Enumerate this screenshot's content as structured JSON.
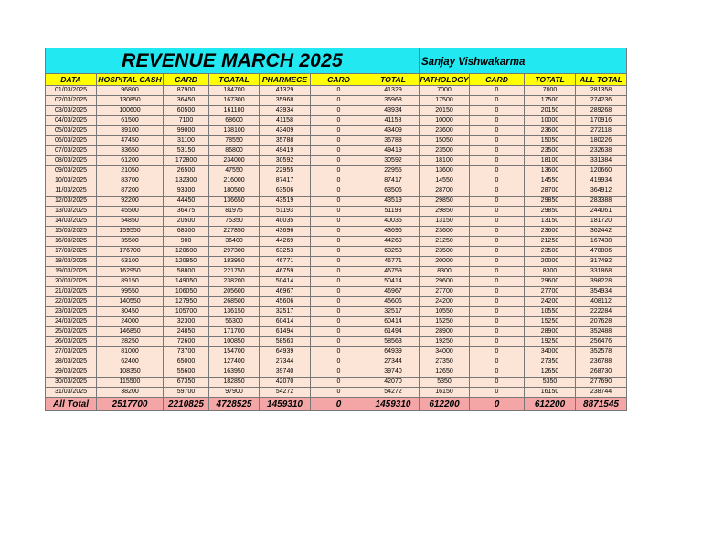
{
  "title": "REVENUE MARCH 2025",
  "author": "Sanjay Vishwakarma",
  "columns": [
    "DATA",
    "HOSPITAL CASH",
    "CARD",
    "TOATAL",
    "PHARMECE",
    "CARD",
    "TOTAL",
    "PATHOLOGY",
    "CARD",
    "TOTATL",
    "ALL TOTAL"
  ],
  "rows": [
    [
      "01/03/2025",
      "96800",
      "87900",
      "184700",
      "41329",
      "0",
      "41329",
      "7000",
      "0",
      "7000",
      "281358"
    ],
    [
      "02/03/2025",
      "130850",
      "36450",
      "167300",
      "35968",
      "0",
      "35968",
      "17500",
      "0",
      "17500",
      "274236"
    ],
    [
      "03/03/2025",
      "100600",
      "60500",
      "161100",
      "43934",
      "0",
      "43934",
      "20150",
      "0",
      "20150",
      "289268"
    ],
    [
      "04/03/2025",
      "61500",
      "7100",
      "68600",
      "41158",
      "0",
      "41158",
      "10000",
      "0",
      "10000",
      "170916"
    ],
    [
      "05/03/2025",
      "39100",
      "99000",
      "138100",
      "43409",
      "0",
      "43409",
      "23600",
      "0",
      "23600",
      "272118"
    ],
    [
      "06/03/2025",
      "47450",
      "31100",
      "78550",
      "35788",
      "0",
      "35788",
      "15050",
      "0",
      "15050",
      "180226"
    ],
    [
      "07/03/2025",
      "33650",
      "53150",
      "86800",
      "49419",
      "0",
      "49419",
      "23500",
      "0",
      "23500",
      "232638"
    ],
    [
      "08/03/2025",
      "61200",
      "172800",
      "234000",
      "30592",
      "0",
      "30592",
      "18100",
      "0",
      "18100",
      "331384"
    ],
    [
      "09/03/2025",
      "21050",
      "26500",
      "47550",
      "22955",
      "0",
      "22955",
      "13600",
      "0",
      "13600",
      "120660"
    ],
    [
      "10/03/2025",
      "83700",
      "132300",
      "216000",
      "87417",
      "0",
      "87417",
      "14550",
      "0",
      "14550",
      "419934"
    ],
    [
      "11/03/2025",
      "87200",
      "93300",
      "180500",
      "63506",
      "0",
      "63506",
      "28700",
      "0",
      "28700",
      "364912"
    ],
    [
      "12/03/2025",
      "92200",
      "44450",
      "136650",
      "43519",
      "0",
      "43519",
      "29850",
      "0",
      "29850",
      "283388"
    ],
    [
      "13/03/2025",
      "45500",
      "36475",
      "81975",
      "51193",
      "0",
      "51193",
      "29850",
      "0",
      "29850",
      "244061"
    ],
    [
      "14/03/2025",
      "54850",
      "20500",
      "75350",
      "40035",
      "0",
      "40035",
      "13150",
      "0",
      "13150",
      "181720"
    ],
    [
      "15/03/2025",
      "159550",
      "68300",
      "227850",
      "43696",
      "0",
      "43696",
      "23600",
      "0",
      "23600",
      "362442"
    ],
    [
      "16/03/2025",
      "35500",
      "900",
      "36400",
      "44269",
      "0",
      "44269",
      "21250",
      "0",
      "21250",
      "167438"
    ],
    [
      "17/03/2025",
      "176700",
      "120600",
      "297300",
      "63253",
      "0",
      "63253",
      "23500",
      "0",
      "23500",
      "470806"
    ],
    [
      "18/03/2025",
      "63100",
      "120850",
      "183950",
      "46771",
      "0",
      "46771",
      "20000",
      "0",
      "20000",
      "317492"
    ],
    [
      "19/03/2025",
      "162950",
      "58800",
      "221750",
      "46759",
      "0",
      "46759",
      "8300",
      "0",
      "8300",
      "331868"
    ],
    [
      "20/03/2025",
      "89150",
      "149050",
      "238200",
      "50414",
      "0",
      "50414",
      "29600",
      "0",
      "29600",
      "398228"
    ],
    [
      "21/03/2025",
      "99550",
      "106050",
      "205600",
      "46967",
      "0",
      "46967",
      "27700",
      "0",
      "27700",
      "354934"
    ],
    [
      "22/03/2025",
      "140550",
      "127950",
      "268500",
      "45606",
      "0",
      "45606",
      "24200",
      "0",
      "24200",
      "408112"
    ],
    [
      "23/03/2025",
      "30450",
      "105700",
      "136150",
      "32517",
      "0",
      "32517",
      "10550",
      "0",
      "10550",
      "222284"
    ],
    [
      "24/03/2025",
      "24000",
      "32300",
      "56300",
      "60414",
      "0",
      "60414",
      "15250",
      "0",
      "15250",
      "207628"
    ],
    [
      "25/03/2025",
      "146850",
      "24850",
      "171700",
      "61494",
      "0",
      "61494",
      "28900",
      "0",
      "28900",
      "352488"
    ],
    [
      "26/03/2025",
      "28250",
      "72600",
      "100850",
      "58563",
      "0",
      "58563",
      "19250",
      "0",
      "19250",
      "256476"
    ],
    [
      "27/03/2025",
      "81000",
      "73700",
      "154700",
      "64939",
      "0",
      "64939",
      "34000",
      "0",
      "34000",
      "352578"
    ],
    [
      "28/03/2025",
      "62400",
      "65000",
      "127400",
      "27344",
      "0",
      "27344",
      "27350",
      "0",
      "27350",
      "236788"
    ],
    [
      "29/03/2025",
      "108350",
      "55600",
      "163950",
      "39740",
      "0",
      "39740",
      "12650",
      "0",
      "12650",
      "268730"
    ],
    [
      "30/03/2025",
      "115500",
      "67350",
      "182850",
      "42070",
      "0",
      "42070",
      "5350",
      "0",
      "5350",
      "277690"
    ],
    [
      "31/03/2025",
      "38200",
      "59700",
      "97900",
      "54272",
      "0",
      "54272",
      "16150",
      "0",
      "16150",
      "238744"
    ]
  ],
  "totals": [
    "All Total",
    "2517700",
    "2210825",
    "4728525",
    "1459310",
    "0",
    "1459310",
    "612200",
    "0",
    "612200",
    "8871545"
  ]
}
